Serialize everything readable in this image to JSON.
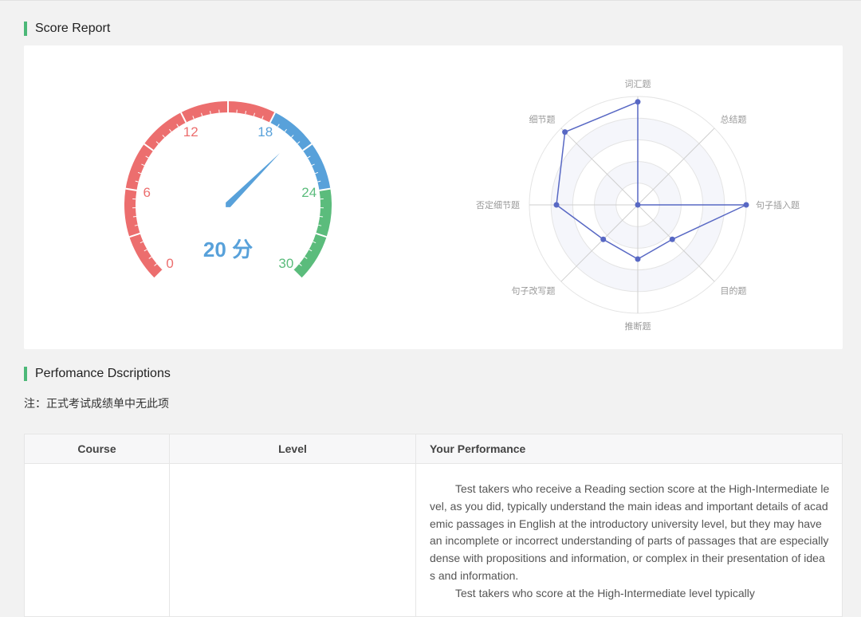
{
  "sections": {
    "score_report_title": "Score Report",
    "performance_title": "Perfomance Dscriptions"
  },
  "gauge": {
    "score": 20,
    "min": 0,
    "max": 30,
    "score_text": "20 分",
    "ticks": [
      "0",
      "6",
      "12",
      "18",
      "24",
      "30"
    ],
    "bands": [
      {
        "from": 0,
        "to": 18,
        "color": "#ec6e6e"
      },
      {
        "from": 18,
        "to": 24,
        "color": "#58a1da"
      },
      {
        "from": 24,
        "to": 30,
        "color": "#5bbc7c"
      }
    ],
    "needle_color": "#58a1da"
  },
  "radar": {
    "indicators": [
      "词汇题",
      "总结题",
      "句子插入题",
      "目的题",
      "推断题",
      "句子改写题",
      "否定细节题",
      "细节题"
    ],
    "values": [
      0.95,
      0,
      1.0,
      0.45,
      0.5,
      0.45,
      0.75,
      0.95
    ],
    "line_color": "#5868c4"
  },
  "note": "注：正式考试成绩单中无此项",
  "table": {
    "headers": {
      "course": "Course",
      "level": "Level",
      "performance": "Your Performance"
    },
    "rows": [
      {
        "course": "",
        "level": "",
        "performance": [
          "Test takers who receive a Reading section score at the High-Intermediate level, as you did, typically understand the main ideas and important details of academic passages in English at the introductory university level, but they may have an incomplete or incorrect understanding of parts of passages that are especially dense with propositions and information, or complex in their presentation of ideas and information.",
          "Test takers who score at the High-Intermediate level typically"
        ]
      }
    ]
  }
}
